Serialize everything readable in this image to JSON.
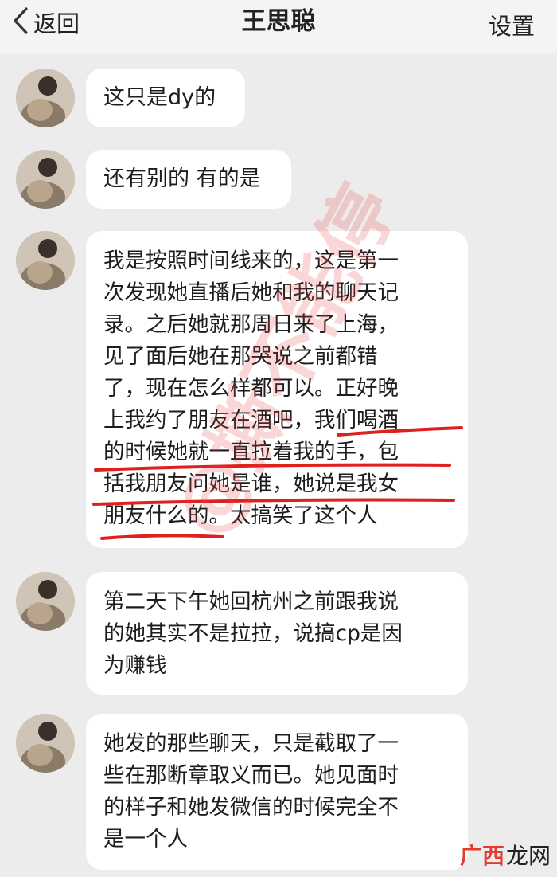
{
  "header": {
    "back_label": "返回",
    "title": "王思聪",
    "settings_label": "设置"
  },
  "messages": [
    {
      "text": "这只是dy的"
    },
    {
      "text": "还有别的 有的是"
    },
    {
      "text": "我是按照时间线来的，这是第一\n次发现她直播后她和我的聊天记\n录。之后她就那周日来了上海，\n见了面后她在那哭说之前都错\n了，现在怎么样都可以。正好晚\n上我约了朋友在酒吧，我们喝酒\n的时候她就一直拉着我的手，包\n括我朋友问她是谁，她说是我女\n朋友什么的。太搞笑了这个人"
    },
    {
      "text": "第二天下午她回杭州之前跟我说\n的她其实不是拉拉，说搞cp是因\n为赚钱"
    },
    {
      "text": "她发的那些聊天，只是截取了一\n些在那断章取义而已。她见面时\n的样子和她发微信的时候完全不\n是一个人"
    }
  ],
  "watermark": {
    "text": "@撕不能停"
  },
  "site_logo": {
    "part1": "广西",
    "part2": "龙网"
  },
  "colors": {
    "underline": "#e0201e",
    "bubble": "#ffffff",
    "background": "#ececec"
  }
}
